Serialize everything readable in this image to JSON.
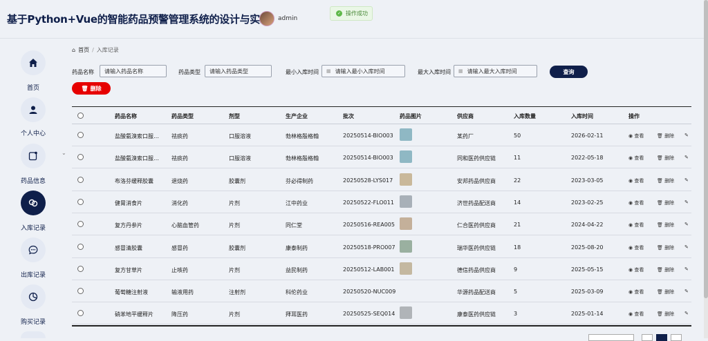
{
  "header": {
    "title": "基于Python+Vue的智能药品预警管理系统的设计与实现",
    "username": "admin"
  },
  "toast": {
    "message": "操作成功"
  },
  "sidebar": {
    "items": [
      {
        "label": "首页",
        "icon": "home-icon"
      },
      {
        "label": "个人中心",
        "icon": "user-icon"
      },
      {
        "label": "药品信息",
        "icon": "note-icon"
      },
      {
        "label": "入库记录",
        "icon": "link-icon",
        "active": true
      },
      {
        "label": "出库记录",
        "icon": "chat-icon"
      },
      {
        "label": "购买记录",
        "icon": "pie-icon"
      }
    ]
  },
  "breadcrumb": {
    "home": "首页",
    "current": "入库记录"
  },
  "search": {
    "name_label": "药品名称",
    "name_placeholder": "请输入药品名称",
    "type_label": "药品类型",
    "type_placeholder": "请输入药品类型",
    "min_label": "最小入库时间",
    "min_placeholder": "请输入最小入库时间",
    "max_label": "最大入库时间",
    "max_placeholder": "请输入最大入库时间",
    "query_label": "查询"
  },
  "toolbar": {
    "delete_label": "删除"
  },
  "table": {
    "columns": [
      "药品名称",
      "药品类型",
      "剂型",
      "生产企业",
      "批次",
      "药品图片",
      "供应商",
      "入库数量",
      "入库时间",
      "操作"
    ],
    "view_label": "查看",
    "delete_label": "删除",
    "rows": [
      {
        "name": "盐酸氨溴索口服…",
        "type": "祛痰药",
        "form": "口服溶液",
        "maker": "勃林格殷格翰",
        "batch": "20250514-BIO003",
        "supplier": "某药厂",
        "qty": "50",
        "date": "2026-02-11",
        "img": "#8fb8c4"
      },
      {
        "name": "盐酸氨溴索口服…",
        "type": "祛痰药",
        "form": "口服溶液",
        "maker": "勃林格殷格翰",
        "batch": "20250514-BIO003",
        "supplier": "同和医药供应链",
        "qty": "11",
        "date": "2022-05-18",
        "img": "#8fb8c4"
      },
      {
        "name": "布洛芬缓释胶囊",
        "type": "退烧药",
        "form": "胶囊剂",
        "maker": "芬必得制药",
        "batch": "20250528-LYS017",
        "supplier": "安邦药品供应商",
        "qty": "22",
        "date": "2023-03-05",
        "img": "#c9b89a"
      },
      {
        "name": "健胃消食片",
        "type": "消化药",
        "form": "片剂",
        "maker": "江中药业",
        "batch": "20250522-FLO011",
        "supplier": "济世药品配送商",
        "qty": "14",
        "date": "2023-02-25",
        "img": "#a8b0b8"
      },
      {
        "name": "复方丹参片",
        "type": "心脑血管药",
        "form": "片剂",
        "maker": "同仁堂",
        "batch": "20250516-REA005",
        "supplier": "仁合医药供应商",
        "qty": "21",
        "date": "2024-04-22",
        "img": "#c4b09a"
      },
      {
        "name": "感冒清胶囊",
        "type": "感冒药",
        "form": "胶囊剂",
        "maker": "康泰制药",
        "batch": "20250518-PRO007",
        "supplier": "瑞华医药供应链",
        "qty": "18",
        "date": "2025-08-20",
        "img": "#9ab0a0"
      },
      {
        "name": "复方甘草片",
        "type": "止咳药",
        "form": "片剂",
        "maker": "益民制药",
        "batch": "20250512-LAB001",
        "supplier": "德信药品供应商",
        "qty": "9",
        "date": "2025-05-15",
        "img": "#c4b8a0"
      },
      {
        "name": "葡萄糖注射液",
        "type": "输液用药",
        "form": "注射剂",
        "maker": "科伦药业",
        "batch": "20250520-NUC009",
        "supplier": "华源药品配送商",
        "qty": "5",
        "date": "2025-03-09",
        "img": ""
      },
      {
        "name": "硝苯地平缓释片",
        "type": "降压药",
        "form": "片剂",
        "maker": "拜耳医药",
        "batch": "20250525-SEQ014",
        "supplier": "康泰医药供应链",
        "qty": "3",
        "date": "2025-01-14",
        "img": "#b0b4b8"
      }
    ]
  }
}
